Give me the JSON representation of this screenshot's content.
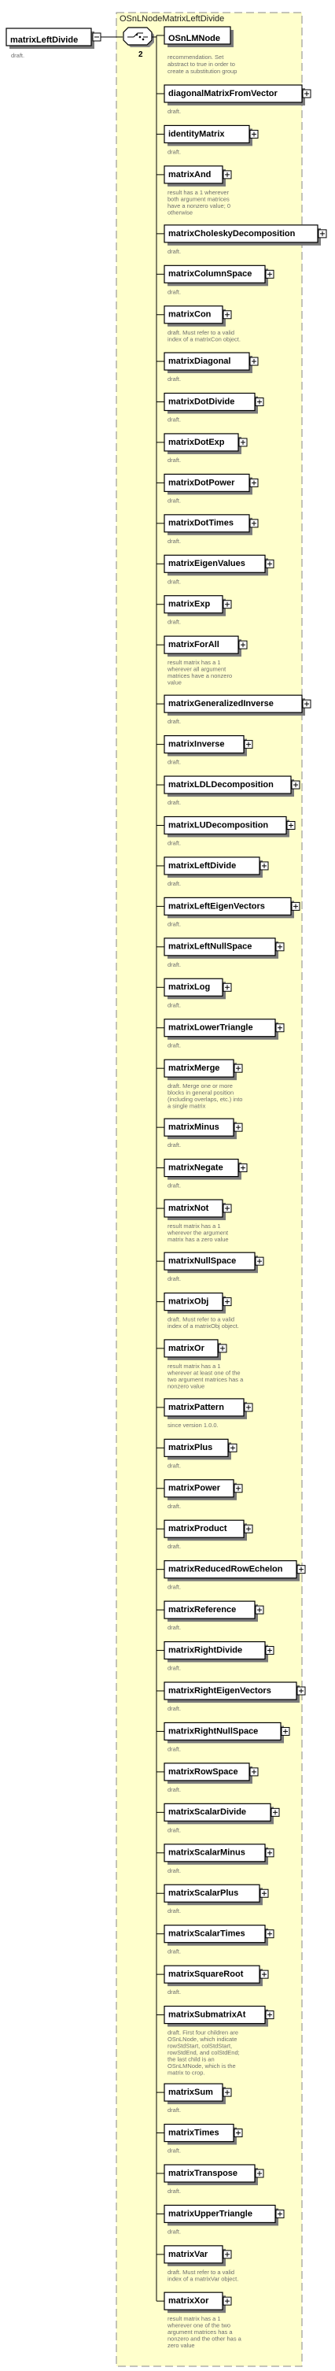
{
  "root": {
    "name": "matrixLeftDivide",
    "doc": "draft."
  },
  "group_title": "OSnLNodeMatrixLeftDivide",
  "first": {
    "name": "OSnLMNode",
    "doc": [
      "recommendation. Set",
      "abstract to true in order to",
      "create a substitution group"
    ]
  },
  "multiplicity": "2",
  "colors": {
    "group_fill": "#ffffcc",
    "group_border": "#8a8a8a",
    "box_fill": "#ffffff",
    "shadow": "#7a7a7a"
  },
  "elements": [
    {
      "name": "diagonalMatrixFromVector",
      "doc": [
        "draft."
      ]
    },
    {
      "name": "identityMatrix",
      "doc": [
        "draft."
      ]
    },
    {
      "name": "matrixAnd",
      "doc": [
        "result has a 1 wherever",
        "both argument matrices",
        "have a nonzero value; 0",
        "otherwise"
      ]
    },
    {
      "name": "matrixCholeskyDecomposition",
      "doc": [
        "draft."
      ]
    },
    {
      "name": "matrixColumnSpace",
      "doc": [
        "draft."
      ]
    },
    {
      "name": "matrixCon",
      "doc": [
        "draft. Must refer to a valid",
        "index of a matrixCon object."
      ]
    },
    {
      "name": "matrixDiagonal",
      "doc": [
        "draft."
      ]
    },
    {
      "name": "matrixDotDivide",
      "doc": [
        "draft."
      ]
    },
    {
      "name": "matrixDotExp",
      "doc": [
        "draft."
      ]
    },
    {
      "name": "matrixDotPower",
      "doc": [
        "draft."
      ]
    },
    {
      "name": "matrixDotTimes",
      "doc": [
        "draft."
      ]
    },
    {
      "name": "matrixEigenValues",
      "doc": [
        "draft."
      ]
    },
    {
      "name": "matrixExp",
      "doc": [
        "draft."
      ]
    },
    {
      "name": "matrixForAll",
      "doc": [
        "result matrix has a 1",
        "wherever all argument",
        "matrices have a nonzero",
        "value"
      ]
    },
    {
      "name": "matrixGeneralizedInverse",
      "doc": [
        "draft."
      ]
    },
    {
      "name": "matrixInverse",
      "doc": [
        "draft."
      ]
    },
    {
      "name": "matrixLDLDecomposition",
      "doc": [
        "draft."
      ]
    },
    {
      "name": "matrixLUDecomposition",
      "doc": [
        "draft."
      ]
    },
    {
      "name": "matrixLeftDivide",
      "doc": [
        "draft."
      ]
    },
    {
      "name": "matrixLeftEigenVectors",
      "doc": [
        "draft."
      ]
    },
    {
      "name": "matrixLeftNullSpace",
      "doc": [
        "draft."
      ]
    },
    {
      "name": "matrixLog",
      "doc": [
        "draft."
      ]
    },
    {
      "name": "matrixLowerTriangle",
      "doc": [
        "draft."
      ]
    },
    {
      "name": "matrixMerge",
      "doc": [
        "draft. Merge one or more",
        "blocks in general position",
        "(including overlaps, etc.) into",
        "a single matrix"
      ]
    },
    {
      "name": "matrixMinus",
      "doc": [
        "draft."
      ]
    },
    {
      "name": "matrixNegate",
      "doc": [
        "draft."
      ]
    },
    {
      "name": "matrixNot",
      "doc": [
        "result matrix has a 1",
        "wherever the argument",
        "matrix has a zero value"
      ]
    },
    {
      "name": "matrixNullSpace",
      "doc": [
        "draft."
      ]
    },
    {
      "name": "matrixObj",
      "doc": [
        "draft. Must refer to a valid",
        "index of a matrixObj object."
      ]
    },
    {
      "name": "matrixOr",
      "doc": [
        "result matrix has a 1",
        "wherever at least one of the",
        "two argument matrices has a",
        "nonzero value"
      ]
    },
    {
      "name": "matrixPattern",
      "doc": [
        "since version 1.0.0."
      ]
    },
    {
      "name": "matrixPlus",
      "doc": [
        "draft."
      ]
    },
    {
      "name": "matrixPower",
      "doc": [
        "draft."
      ]
    },
    {
      "name": "matrixProduct",
      "doc": [
        "draft."
      ]
    },
    {
      "name": "matrixReducedRowEchelon",
      "doc": [
        "draft."
      ]
    },
    {
      "name": "matrixReference",
      "doc": [
        "draft."
      ]
    },
    {
      "name": "matrixRightDivide",
      "doc": [
        "draft."
      ]
    },
    {
      "name": "matrixRightEigenVectors",
      "doc": [
        "draft."
      ]
    },
    {
      "name": "matrixRightNullSpace",
      "doc": [
        "draft."
      ]
    },
    {
      "name": "matrixRowSpace",
      "doc": [
        "draft."
      ]
    },
    {
      "name": "matrixScalarDivide",
      "doc": [
        "draft."
      ]
    },
    {
      "name": "matrixScalarMinus",
      "doc": [
        "draft."
      ]
    },
    {
      "name": "matrixScalarPlus",
      "doc": [
        "draft."
      ]
    },
    {
      "name": "matrixScalarTimes",
      "doc": [
        "draft."
      ]
    },
    {
      "name": "matrixSquareRoot",
      "doc": [
        "draft."
      ]
    },
    {
      "name": "matrixSubmatrixAt",
      "doc": [
        "draft. First four children are",
        "OSnLNode, which indicate",
        "rowStdStart, colStdStart,",
        "rowStdEnd, and colStdEnd;",
        "the last child is an",
        "OSnLMNode, which is the",
        "matrix to crop."
      ]
    },
    {
      "name": "matrixSum",
      "doc": [
        "draft."
      ]
    },
    {
      "name": "matrixTimes",
      "doc": [
        "draft."
      ]
    },
    {
      "name": "matrixTranspose",
      "doc": [
        "draft."
      ]
    },
    {
      "name": "matrixUpperTriangle",
      "doc": [
        "draft."
      ]
    },
    {
      "name": "matrixVar",
      "doc": [
        "draft. Must refer to a valid",
        "index of a matrixVar object."
      ]
    },
    {
      "name": "matrixXor",
      "doc": [
        "result matrix has a 1",
        "wherever one of the two",
        "argument matrices has a",
        "nonzero and the other has a",
        "zero value"
      ]
    }
  ]
}
